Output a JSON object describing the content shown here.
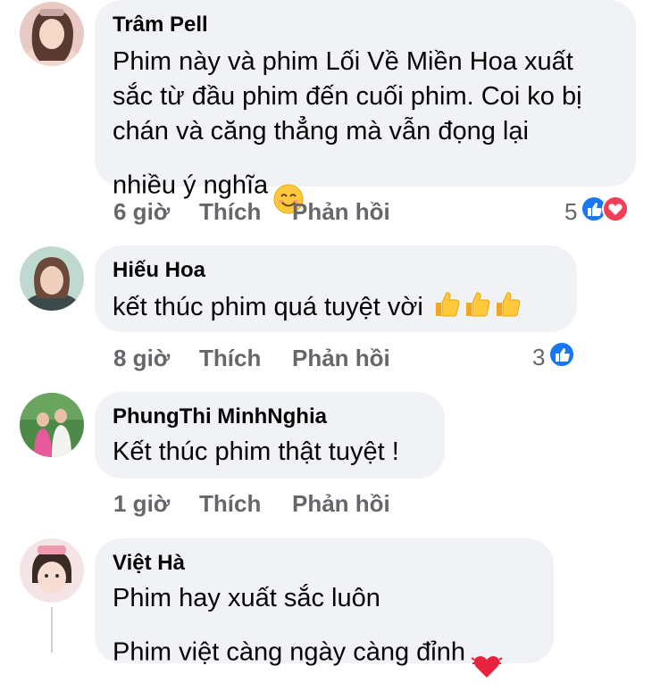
{
  "comments": [
    {
      "author": "Trâm Pell",
      "text": "Phim này và phim Lối Về Miền Hoa xuất\nsắc từ đầu phim đến cuối phim. Coi ko bị\nchán và căng thẳng mà vẫn đọng lại\nnhiều ý nghĩa",
      "emoji": "smiling-face-icon",
      "time": "6 giờ",
      "like": "Thích",
      "reply": "Phản hồi",
      "reaction_count": "5",
      "reactions": [
        "like",
        "love"
      ]
    },
    {
      "author": "Hiếu Hoa",
      "text": "kết thúc phim quá tuyệt vời",
      "emoji": "thumbs-up-icon",
      "emoji_repeat": 3,
      "time": "8 giờ",
      "like": "Thích",
      "reply": "Phản hồi",
      "reaction_count": "3",
      "reactions": [
        "like"
      ]
    },
    {
      "author": "PhungThi MinhNghia",
      "text": "Kết thúc phim thật tuyệt !",
      "time": "1 giờ",
      "like": "Thích",
      "reply": "Phản hồi"
    },
    {
      "author": "Việt Hà",
      "text": "Phim hay xuất sắc luôn\nPhim việt càng ngày càng đỉnh",
      "emoji": "beating-heart-icon"
    }
  ],
  "colors": {
    "bubble": "#f0f2f5",
    "meta_text": "#65676b",
    "like_blue": "#1877f2",
    "love_red": "#f33e58"
  }
}
